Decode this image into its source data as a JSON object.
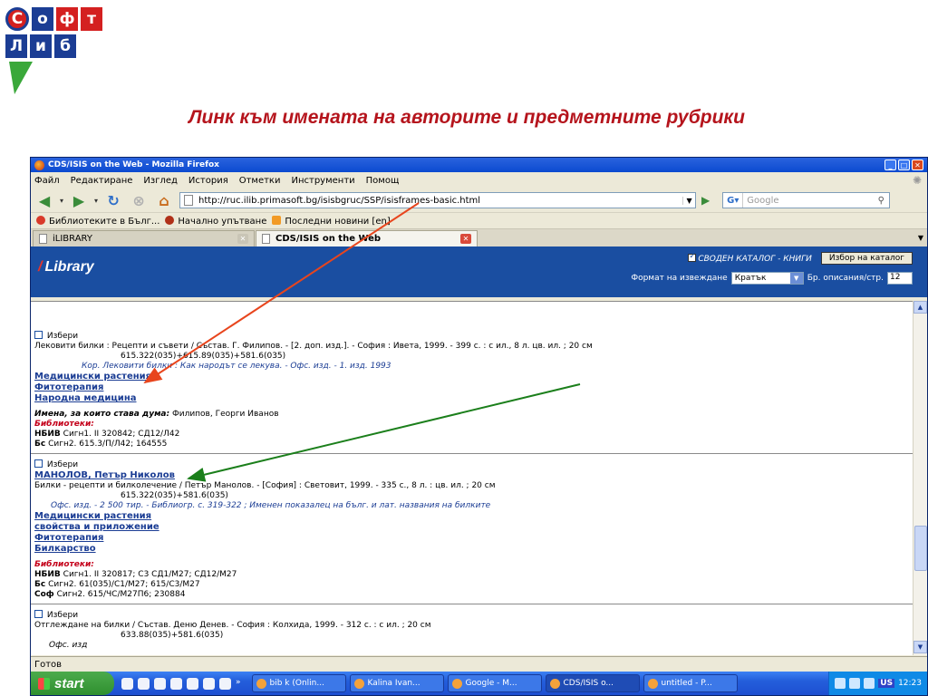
{
  "slide": {
    "title": "Линк към имената на авторите и предметните рубрики",
    "logo": {
      "row1": [
        "С",
        "о",
        "ф",
        "т"
      ],
      "row2": [
        "Л",
        "и",
        "б"
      ]
    }
  },
  "window": {
    "title": "CDS/ISIS on the Web - Mozilla Firefox"
  },
  "menu": [
    "Файл",
    "Редактиране",
    "Изглед",
    "История",
    "Отметки",
    "Инструменти",
    "Помощ"
  ],
  "address": {
    "url": "http://ruc.ilib.primasoft.bg/isisbgruc/SSP/isisframes-basic.html"
  },
  "search": {
    "placeholder": "Google"
  },
  "bookmarks": [
    "Библиотеките в Бълг...",
    "Начално упътване",
    "Последни новини [en]"
  ],
  "tabs": [
    {
      "label": "iLIBRARY"
    },
    {
      "label": "CDS/ISIS on the Web"
    }
  ],
  "lib_header": {
    "logo": "Library",
    "catalog_label": "СВОДЕН КАТАЛОГ - КНИГИ",
    "catalog_button": "Избор на каталог",
    "format_label": "Формат на извеждане",
    "format_value": "Кратък",
    "per_page_label": "Бр. описания/стр.",
    "per_page_value": "12"
  },
  "records": [
    {
      "select_label": "Избери",
      "description": "Лековити билки : Рецепти и съвети / Състав. Г. Филипов. - [2. доп. изд.]. - София : Ивета, 1999. - 399 с. : с ил., 8 л. цв. ил. ; 20 см",
      "udc": "615.322(035)+615.89(035)+581.6(035)",
      "note": "Кор. Лековити билки : Как народът се лекува. - Офс. изд. - 1. изд. 1993",
      "subjects": [
        "Медицински растения",
        "Фитотерапия",
        "Народна медицина"
      ],
      "names_label": "Имена, за които става дума:",
      "names_value": "Филипов, Георги Иванов",
      "libraries_label": "Библиотеки:",
      "holdings": [
        {
          "lib": "НБИВ",
          "text": "Сигн1. II 320842; СД12/Л42"
        },
        {
          "lib": "Бс",
          "text": "Сигн2. 615.3/П/Л42; 164555"
        }
      ]
    },
    {
      "select_label": "Избери",
      "author": "МАНОЛОВ, Петър Николов",
      "description": "Билки - рецепти и билколечение / Петър Манолов. - [София] : Световит, 1999. - 335 с., 8 л. : цв. ил. ; 20 см",
      "udc": "615.322(035)+581.6(035)",
      "note": "Офс. изд. - 2 500 тир. - Библиогр. с. 319-322 ; Именен показалец на бълг. и лат. названия на билките",
      "subjects": [
        "Медицински растения",
        "свойства и приложение",
        "Фитотерапия",
        "Билкарство"
      ],
      "libraries_label": "Библиотеки:",
      "holdings": [
        {
          "lib": "НБИВ",
          "text": "Сигн1. II 320817; С3 СД1/М27; СД12/М27"
        },
        {
          "lib": "Бс",
          "text": "Сигн2. 61(035)/С1/М27; 615/С3/М27"
        },
        {
          "lib": "Соф",
          "text": "Сигн2. 615/ЧС/М27П6; 230884"
        }
      ]
    },
    {
      "select_label": "Избери",
      "description": "Отглеждане на билки / Състав. Деню Денев. - София : Колхида, 1999. - 312 с. : с ил. ; 20 см",
      "udc": "633.88(035)+581.6(035)",
      "note": "Офс. изд"
    }
  ],
  "status": "Готов",
  "taskbar": {
    "start": "start",
    "tasks": [
      "bib k (Onlin...",
      "Kalina Ivan...",
      "Google - M...",
      "CDS/ISIS o...",
      "untitled - P..."
    ],
    "lang": "US",
    "time": "12:23"
  }
}
